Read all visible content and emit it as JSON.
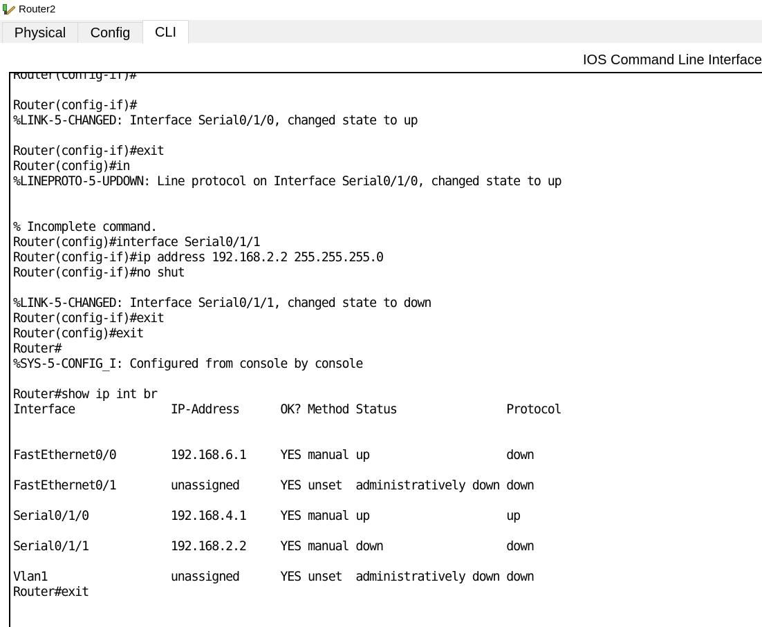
{
  "window": {
    "title": "Router2",
    "icon": "router-icon"
  },
  "tabs": [
    {
      "label": "Physical",
      "active": false
    },
    {
      "label": "Config",
      "active": false
    },
    {
      "label": "CLI",
      "active": true
    }
  ],
  "cli": {
    "heading": "IOS Command Line Interface",
    "lines": [
      "Router(config-if)#",
      "",
      "Router(config-if)#",
      "%LINK-5-CHANGED: Interface Serial0/1/0, changed state to up",
      "",
      "Router(config-if)#exit",
      "Router(config)#in",
      "%LINEPROTO-5-UPDOWN: Line protocol on Interface Serial0/1/0, changed state to up",
      "",
      "",
      "% Incomplete command.",
      "Router(config)#interface Serial0/1/1",
      "Router(config-if)#ip address 192.168.2.2 255.255.255.0",
      "Router(config-if)#no shut",
      "",
      "%LINK-5-CHANGED: Interface Serial0/1/1, changed state to down",
      "Router(config-if)#exit",
      "Router(config)#exit",
      "Router#",
      "%SYS-5-CONFIG_I: Configured from console by console",
      "",
      "Router#show ip int br",
      "Interface              IP-Address      OK? Method Status                Protocol",
      "",
      "",
      "FastEthernet0/0        192.168.6.1     YES manual up                    down",
      "",
      "FastEthernet0/1        unassigned      YES unset  administratively down down",
      "",
      "Serial0/1/0            192.168.4.1     YES manual up                    up",
      "",
      "Serial0/1/1            192.168.2.2     YES manual down                  down",
      "",
      "Vlan1                  unassigned      YES unset  administratively down down",
      "Router#exit",
      ""
    ]
  }
}
